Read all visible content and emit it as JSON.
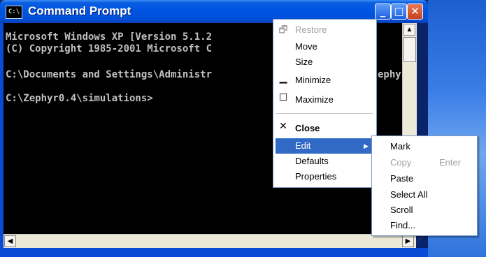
{
  "window": {
    "title": "Command Prompt",
    "app_icon": "C:\\",
    "buttons": {
      "minimize": "_",
      "maximize": "□",
      "close": "✕"
    }
  },
  "console": {
    "lines": [
      "Microsoft Windows XP [Version 5.1.2",
      "(C) Copyright 1985-2001 Microsoft C",
      "",
      "C:\\Documents and Settings\\Administr",
      "",
      "C:\\Zephyr0.4\\simulations>"
    ],
    "partial_text": "ephy"
  },
  "system_menu": {
    "items": [
      {
        "label": "Restore",
        "icon": "restore-icon",
        "glyph": "🗗",
        "disabled": true
      },
      {
        "label": "Move",
        "icon": "",
        "glyph": "",
        "disabled": false
      },
      {
        "label": "Size",
        "icon": "",
        "glyph": "",
        "disabled": false
      },
      {
        "label": "Minimize",
        "icon": "minimize-icon",
        "glyph": "▁",
        "disabled": false
      },
      {
        "label": "Maximize",
        "icon": "maximize-icon",
        "glyph": "☐",
        "disabled": false
      },
      {
        "label": "Close",
        "icon": "close-icon",
        "glyph": "✕",
        "disabled": false
      },
      {
        "label": "Edit",
        "submenu_arrow": "▶",
        "selected": true
      },
      {
        "label": "Defaults",
        "disabled": false
      },
      {
        "label": "Properties",
        "disabled": false
      }
    ]
  },
  "edit_submenu": {
    "items": [
      {
        "label": "Mark",
        "shortcut": "",
        "disabled": false
      },
      {
        "label": "Copy",
        "shortcut": "Enter",
        "disabled": true
      },
      {
        "label": "Paste",
        "shortcut": "",
        "disabled": false
      },
      {
        "label": "Select All",
        "shortcut": "",
        "disabled": false
      },
      {
        "label": "Scroll",
        "shortcut": "",
        "disabled": false
      },
      {
        "label": "Find...",
        "shortcut": "",
        "disabled": false
      }
    ]
  },
  "scrollbars": {
    "up": "▲",
    "down": "▼",
    "left": "◀",
    "right": "▶"
  }
}
